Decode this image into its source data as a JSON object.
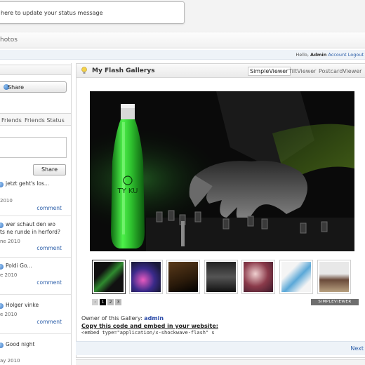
{
  "status": {
    "placeholder": "here to update your status message"
  },
  "tabs": {
    "current": "hotos"
  },
  "userbar": {
    "hello": "Hello,",
    "username": "Admin",
    "account": "Account",
    "logout": "Logout"
  },
  "left": {
    "share_label": "Share",
    "friend_tabs": [
      "Friends",
      "Friends Status"
    ],
    "share2_label": "Share",
    "posts": [
      {
        "message": "jetzt geht's los...",
        "message2": "",
        "date": "2010",
        "comment": "comment"
      },
      {
        "message": "wer schaut den wo",
        "message2": "ts ne runde in herford?",
        "date": "ne 2010",
        "comment": "comment"
      },
      {
        "message": "Poldi Go...",
        "message2": "",
        "date": "e 2010",
        "comment": "comment"
      },
      {
        "message": "Holger vinke",
        "message2": "",
        "date": "e 2010",
        "comment": "comment"
      },
      {
        "message": "Good night",
        "message2": "",
        "date": "ay 2010",
        "comment": ""
      }
    ]
  },
  "gallery": {
    "title": "My Flash Gallerys",
    "viewers": [
      "SimpleViewer",
      "TiltViewer",
      "PostcardViewer"
    ],
    "active_viewer": "SimpleViewer",
    "pages": [
      "1",
      "2",
      "3"
    ],
    "active_page": "1",
    "viewer_label": "SIMPLEVIEWER",
    "bottle_text": "TY KU",
    "owner_label": "Owner of this Gallery:",
    "owner": "admin",
    "copy_label": "Copy this code and embed in your website:",
    "embed_code": "<embed type=\"application/x-shockwave-flash\" s",
    "next": "Next"
  },
  "colors": {
    "link": "#2a5da8",
    "bottle_green": "#3cd23c",
    "viewer_bg": "#0a0a0a"
  }
}
